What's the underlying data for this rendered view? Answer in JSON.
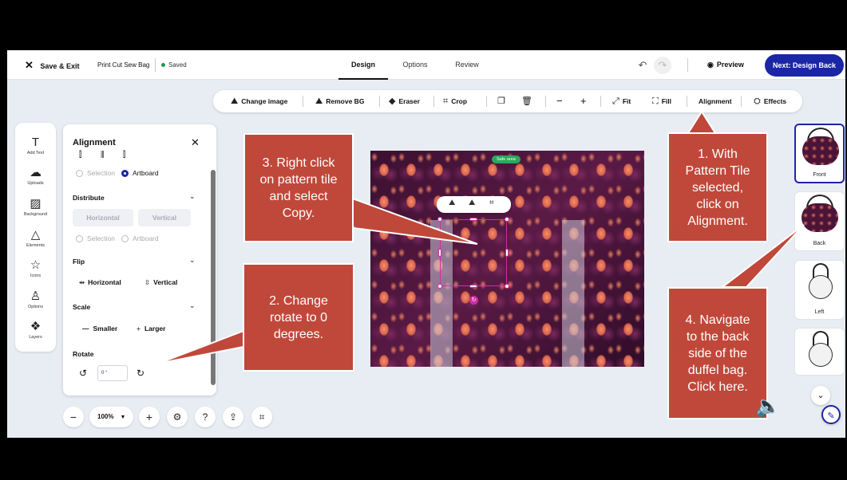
{
  "header": {
    "save_exit": "Save & Exit",
    "project_name": "Print Cut Sew Bag",
    "saved_status": "Saved",
    "tabs": [
      {
        "label": "Design"
      },
      {
        "label": "Options"
      },
      {
        "label": "Review"
      }
    ],
    "preview": "Preview",
    "next": "Next: Design Back"
  },
  "toolbar": {
    "change_image": "Change image",
    "remove_bg": "Remove BG",
    "eraser": "Eraser",
    "crop": "Crop",
    "minus": "−",
    "plus": "+",
    "fit": "Fit",
    "fill": "Fill",
    "alignment": "Alignment",
    "effects": "Effects"
  },
  "rail": {
    "items": [
      {
        "label": "Add Text",
        "icon": "text-icon"
      },
      {
        "label": "Uploads",
        "icon": "upload-icon"
      },
      {
        "label": "Background",
        "icon": "background-icon"
      },
      {
        "label": "Elements",
        "icon": "elements-icon"
      },
      {
        "label": "Icons",
        "icon": "star-icon"
      },
      {
        "label": "Options",
        "icon": "shirt-icon"
      },
      {
        "label": "Layers",
        "icon": "layers-icon"
      }
    ]
  },
  "panel": {
    "title": "Alignment",
    "radio_selection": "Selection",
    "radio_artboard": "Artboard",
    "distribute": {
      "title": "Distribute",
      "horizontal": "Horizontal",
      "vertical": "Vertical"
    },
    "flip": {
      "title": "Flip",
      "horizontal": "Horizontal",
      "vertical": "Vertical"
    },
    "scale": {
      "title": "Scale",
      "smaller": "Smaller",
      "larger": "Larger"
    },
    "rotate": {
      "title": "Rotate",
      "value": "0 °"
    }
  },
  "canvas": {
    "safe_area": "Safe area"
  },
  "thumbnails": [
    {
      "label": "Front",
      "active": true
    },
    {
      "label": "Back",
      "active": false
    },
    {
      "label": "Left",
      "active": false
    }
  ],
  "zoom": {
    "value": "100%"
  },
  "callouts": {
    "c1": "1. With\nPattern Tile\nselected,\nclick on\nAlignment.",
    "c2": "2. Change\nrotate to 0\ndegrees.",
    "c3": "3. Right click\non pattern tile\nand select\nCopy.",
    "c4": "4. Navigate\nto the back\nside of the\nduffel bag.\nClick here."
  },
  "colors": {
    "accent": "#1b26a6",
    "callout": "#c0483a",
    "selection": "#d12da3",
    "saved": "#1d9a52"
  }
}
